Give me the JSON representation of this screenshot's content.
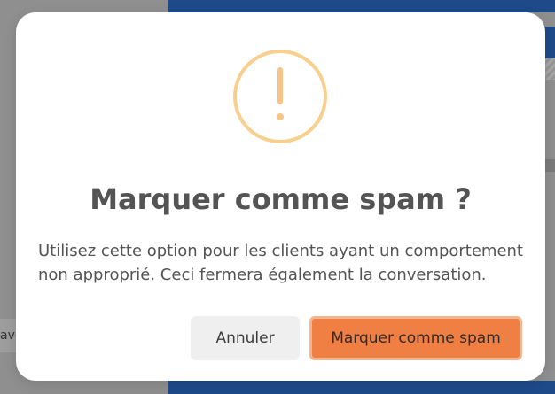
{
  "background": {
    "side_text": "ave"
  },
  "dialog": {
    "title": "Marquer comme spam ?",
    "message": "Utilisez cette option pour les clients ayant un comportement non approprié. Ceci fermera également la conversation.",
    "icon": "exclamation-warning-icon",
    "cancel_label": "Annuler",
    "confirm_label": "Marquer comme spam"
  },
  "colors": {
    "icon_accent": "#f8c486",
    "confirm_button": "#f07f43",
    "cancel_button": "#efefef",
    "background_panel": "#1e4a8a"
  }
}
